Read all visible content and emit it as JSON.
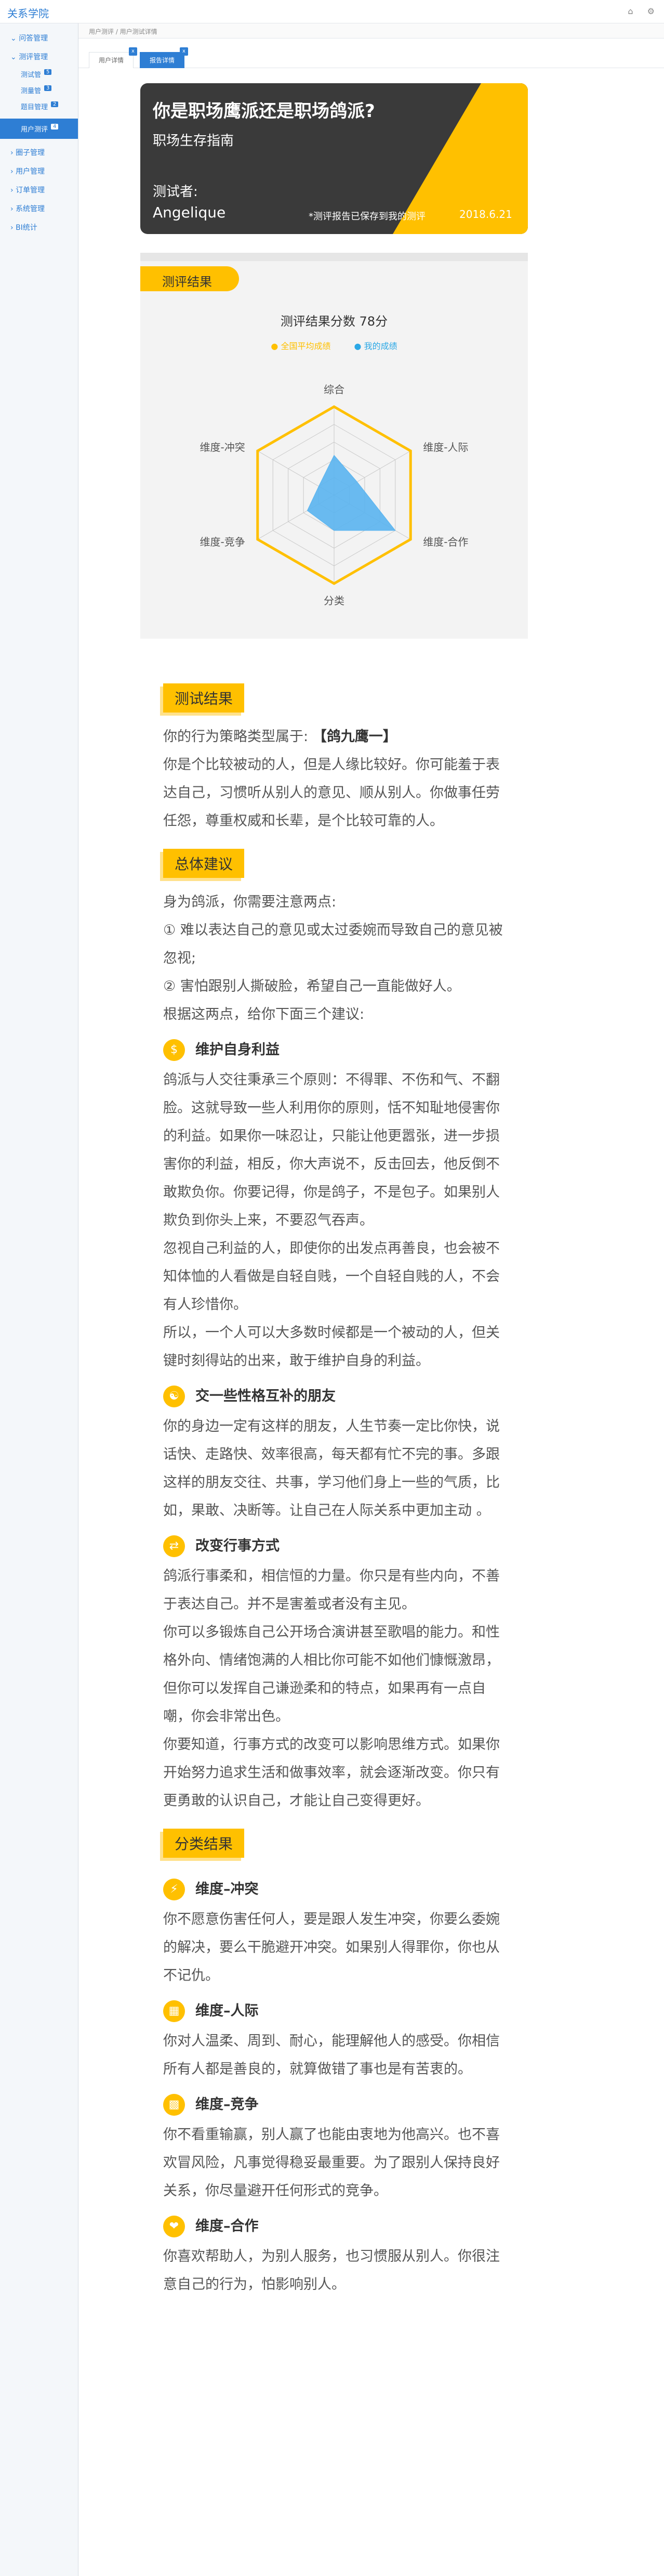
{
  "app": {
    "brand": "关系学院"
  },
  "top_icons": [
    "home-icon",
    "settings-icon"
  ],
  "sidebar": {
    "items": [
      {
        "label": "问答管理"
      },
      {
        "label": "测评管理"
      }
    ],
    "subs": [
      {
        "label": "测试管",
        "badge": "5"
      },
      {
        "label": "测量管",
        "badge": "3"
      },
      {
        "label": "题目管理",
        "badge": "2"
      }
    ],
    "active": {
      "label": "用户测评",
      "badge": "4"
    },
    "more": [
      {
        "label": "圈子管理"
      },
      {
        "label": "用户管理"
      },
      {
        "label": "订单管理"
      },
      {
        "label": "系统管理"
      },
      {
        "label": "BI统计"
      }
    ]
  },
  "breadcrumb": "用户测评 / 用户测试详情",
  "tabs": [
    {
      "label": "用户详情",
      "close": "x"
    },
    {
      "label": "报告详情",
      "close": "x"
    }
  ],
  "hero": {
    "title": "你是职场鹰派还是职场鸽派?",
    "subtitle": "职场生存指南",
    "tester_label": "测试者:",
    "tester_name": "Angelique",
    "note": "*测评报告已保存到我的测评",
    "date": "2018.6.21",
    "colors": {
      "dark": "#3a3a3a",
      "accent": "#ffc000"
    }
  },
  "result": {
    "tag": "测评结果",
    "score_title": "测评结果分数 78分",
    "legend": [
      "全国平均成绩",
      "我的成绩"
    ],
    "axes": [
      "综合",
      "维度-人际",
      "维度-合作",
      "分类",
      "维度-竞争",
      "维度-冲突"
    ]
  },
  "chart_data": {
    "type": "radar",
    "title": "测评结果分数 78分",
    "axes": [
      "综合",
      "维度-人际",
      "维度-合作",
      "分类",
      "维度-竞争",
      "维度-冲突"
    ],
    "range": [
      0,
      100
    ],
    "series": [
      {
        "name": "全国平均成绩",
        "color": "#ffc000",
        "values": [
          100,
          100,
          100,
          100,
          100,
          100
        ]
      },
      {
        "name": "我的成绩",
        "color": "#5ab4ef",
        "values": [
          45,
          30,
          80,
          40,
          35,
          20
        ]
      }
    ]
  },
  "article": {
    "s1": {
      "title": "测试结果",
      "p1_prefix": "你的行为策略类型属于:",
      "p1_type": "【鸽九鹰一】",
      "p2": "你是个比较被动的人，但是人缘比较好。你可能羞于表达自己，习惯听从别人的意见、顺从别人。你做事任劳任怨，尊重权威和长辈，是个比较可靠的人。"
    },
    "s2": {
      "title": "总体建议",
      "p1": "身为鸽派，你需要注意两点:",
      "p2": "① 难以表达自己的意见或太过委婉而导致自己的意见被忽视;",
      "p3": "② 害怕跟别人撕破脸，希望自己一直能做好人。",
      "p4": "根据这两点，给你下面三个建议:",
      "h1": "维护自身利益",
      "h1_p1": "鸽派与人交往秉承三个原则：不得罪、不伤和气、不翻脸。这就导致一些人利用你的原则，恬不知耻地侵害你的利益。如果你一味忍让，只能让他更嚣张，进一步损害你的利益，相反，你大声说不，反击回去，他反倒不敢欺负你。你要记得，你是鸽子，不是包子。如果别人欺负到你头上来，不要忍气吞声。",
      "h1_p2": "忽视自己利益的人，即使你的出发点再善良，也会被不知体恤的人看做是自轻自贱，一个自轻自贱的人，不会有人珍惜你。",
      "h1_p3": "所以，一个人可以大多数时候都是一个被动的人，但关键时刻得站的出来，敢于维护自身的利益。",
      "h2": "交一些性格互补的朋友",
      "h2_p1": "你的身边一定有这样的朋友，人生节奏一定比你快，说话快、走路快、效率很高，每天都有忙不完的事。多跟这样的朋友交往、共事，学习他们身上一些的气质，比如，果敢、决断等。让自己在人际关系中更加主动 。",
      "h3": "改变行事方式",
      "h3_p1": "鸽派行事柔和，相信恒的力量。你只是有些内向，不善于表达自己。并不是害羞或者没有主见。",
      "h3_p2": "你可以多锻炼自己公开场合演讲甚至歌唱的能力。和性格外向、情绪饱满的人相比你可能不如他们慷慨激昂，但你可以发挥自己谦逊柔和的特点，如果再有一点自嘲，你会非常出色。",
      "h3_p3": "你要知道，行事方式的改变可以影响思维方式。如果你开始努力追求生活和做事效率，就会逐渐改变。你只有更勇敢的认识自己，才能让自己变得更好。"
    },
    "s3": {
      "title": "分类结果",
      "d1": "维度–冲突",
      "d1_p": "你不愿意伤害任何人，要是跟人发生冲突，你要么委婉的解决，要么干脆避开冲突。如果别人得罪你，你也从不记仇。",
      "d2": "维度–人际",
      "d2_p": "你对人温柔、周到、耐心，能理解他人的感受。你相信所有人都是善良的，就算做错了事也是有苦衷的。",
      "d3": "维度–竞争",
      "d3_p": "你不看重输赢，别人赢了也能由衷地为他高兴。也不喜欢冒风险，凡事觉得稳妥最重要。为了跟别人保持良好关系，你尽量避开任何形式的竞争。",
      "d4": "维度–合作",
      "d4_p": "你喜欢帮助人，为别人服务，也习惯服从别人。你很注意自己的行为，怕影响别人。"
    },
    "icon_names": {
      "h1": "money-bag-icon",
      "h2": "handshake-icon",
      "h3": "swap-icon",
      "d1": "conflict-icon",
      "d2": "people-icon",
      "d3": "podium-icon",
      "d4": "cooperation-icon"
    }
  }
}
